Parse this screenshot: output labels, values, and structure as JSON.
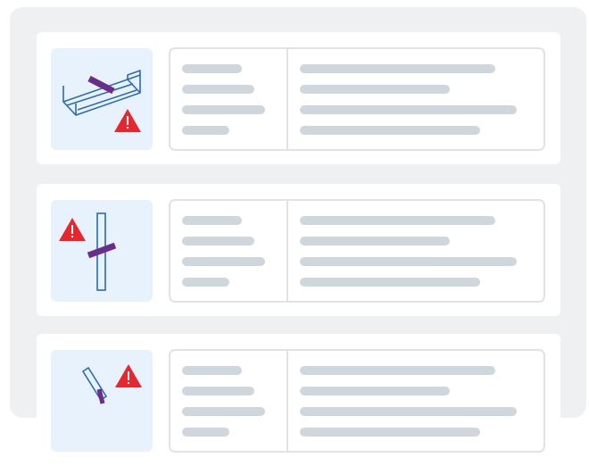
{
  "colors": {
    "outer_background": "#eef0f1",
    "card_background": "#ffffff",
    "thumbnail_background": "#e8f2fc",
    "placeholder_line": "#cfd6dc",
    "panel_border": "#dfe3e6",
    "highlight_bar": "#6b2d8c",
    "warning": "#e8262d",
    "outline": "#2b6cb0"
  },
  "cards": [
    {
      "illustration": "horizontal-channel-with-band",
      "warning_icon": "warning-triangle-icon",
      "warning_position": "bottom-right"
    },
    {
      "illustration": "vertical-post-with-band",
      "warning_icon": "warning-triangle-icon",
      "warning_position": "top-left"
    },
    {
      "illustration": "diagonal-post-with-band",
      "warning_icon": "warning-triangle-icon",
      "warning_position": "top-right"
    }
  ]
}
